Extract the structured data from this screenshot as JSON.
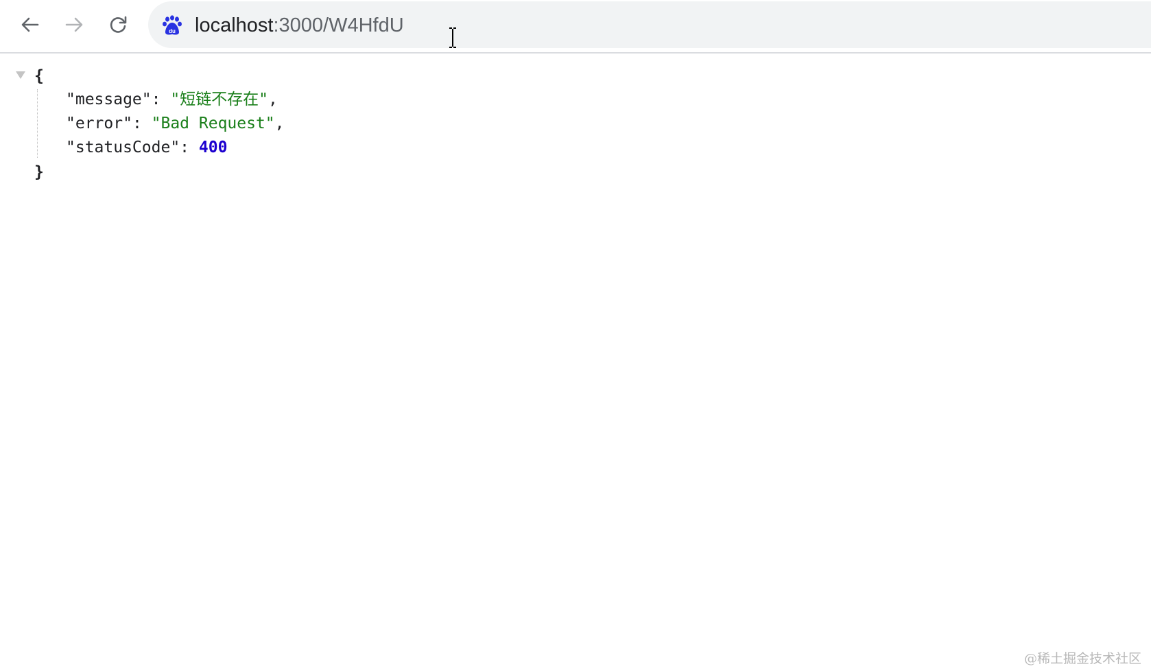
{
  "toolbar": {
    "back_icon": "arrow-left-icon",
    "forward_icon": "arrow-right-icon",
    "reload_icon": "reload-icon"
  },
  "omnibox": {
    "site_icon": "baidu-paw-icon",
    "url_host": "localhost",
    "url_path": ":3000/W4HfdU"
  },
  "json": {
    "open_brace": "{",
    "close_brace": "}",
    "lines": [
      {
        "key": "\"message\"",
        "sep": ": ",
        "value": "\"短链不存在\"",
        "trail": ","
      },
      {
        "key": "\"error\"",
        "sep": ": ",
        "value": "\"Bad Request\"",
        "trail": ","
      },
      {
        "key": "\"statusCode\"",
        "sep": ": ",
        "value": "400",
        "trail": ""
      }
    ]
  },
  "watermark": "@稀土掘金技术社区",
  "colors": {
    "string": "#1a7f1a",
    "number": "#1c00cf",
    "omnibox_bg": "#f1f3f4"
  }
}
